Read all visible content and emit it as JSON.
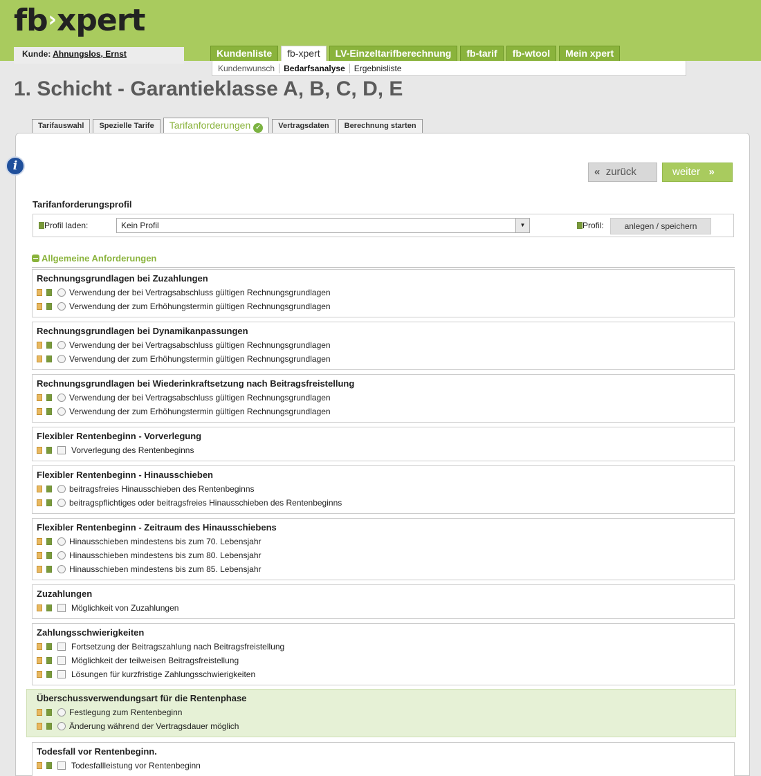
{
  "header": {
    "logo_left": "fb",
    "logo_right": "xpert",
    "customer_label": "Kunde:",
    "customer_name": "Ahnungslos, Ernst",
    "tabs": [
      {
        "label": "Kundenliste",
        "active": false
      },
      {
        "label": "fb-xpert",
        "active": true
      },
      {
        "label": "LV-Einzeltarifberechnung",
        "active": false
      },
      {
        "label": "fb-tarif",
        "active": false
      },
      {
        "label": "fb-wtool",
        "active": false
      },
      {
        "label": "Mein xpert",
        "active": false
      }
    ],
    "subnav": [
      {
        "label": "Kundenwunsch",
        "active": false
      },
      {
        "label": "Bedarfsanalyse",
        "active": true
      },
      {
        "label": "Ergebnisliste",
        "active": false
      }
    ]
  },
  "page_title": "1. Schicht - Garantieklasse A, B, C, D, E",
  "subtabs": [
    {
      "label": "Tarifauswahl",
      "active": false
    },
    {
      "label": "Spezielle Tarife",
      "active": false
    },
    {
      "label": "Tarifanforderungen",
      "active": true
    },
    {
      "label": "Vertragsdaten",
      "active": false
    },
    {
      "label": "Berechnung starten",
      "active": false
    }
  ],
  "nav": {
    "back_label": "zurück",
    "next_label": "weiter"
  },
  "profile": {
    "title": "Tarifanforderungsprofil",
    "load_label": "Profil laden:",
    "select_value": "Kein Profil",
    "profile_label": "Profil:",
    "save_label": "anlegen / speichern"
  },
  "section_title": "Allgemeine Anforderungen",
  "groups": [
    {
      "title": "Rechnungsgrundlagen bei Zuzahlungen",
      "control": "radio",
      "highlight": false,
      "options": [
        "Verwendung der bei Vertragsabschluss gültigen Rechnungsgrundlagen",
        "Verwendung der zum Erhöhungstermin gültigen Rechnungsgrundlagen"
      ]
    },
    {
      "title": "Rechnungsgrundlagen bei Dynamikanpassungen",
      "control": "radio",
      "highlight": false,
      "options": [
        "Verwendung der bei Vertragsabschluss gültigen Rechnungsgrundlagen",
        "Verwendung der zum Erhöhungstermin gültigen Rechnungsgrundlagen"
      ]
    },
    {
      "title": "Rechnungsgrundlagen bei Wiederinkraftsetzung nach Beitragsfreistellung",
      "control": "radio",
      "highlight": false,
      "options": [
        "Verwendung der bei Vertragsabschluss gültigen Rechnungsgrundlagen",
        "Verwendung der zum Erhöhungstermin gültigen Rechnungsgrundlagen"
      ]
    },
    {
      "title": "Flexibler Rentenbeginn - Vorverlegung",
      "control": "checkbox",
      "highlight": false,
      "options": [
        "Vorverlegung des Rentenbeginns"
      ]
    },
    {
      "title": "Flexibler Rentenbeginn - Hinausschieben",
      "control": "radio",
      "highlight": false,
      "options": [
        "beitragsfreies Hinausschieben des Rentenbeginns",
        "beitragspflichtiges oder beitragsfreies Hinausschieben des Rentenbeginns"
      ]
    },
    {
      "title": "Flexibler Rentenbeginn - Zeitraum des Hinausschiebens",
      "control": "radio",
      "highlight": false,
      "options": [
        "Hinausschieben mindestens bis zum 70. Lebensjahr",
        "Hinausschieben mindestens bis zum 80. Lebensjahr",
        "Hinausschieben mindestens bis zum 85. Lebensjahr"
      ]
    },
    {
      "title": "Zuzahlungen",
      "control": "checkbox",
      "highlight": false,
      "options": [
        "Möglichkeit von Zuzahlungen"
      ]
    },
    {
      "title": "Zahlungsschwierigkeiten",
      "control": "checkbox",
      "highlight": false,
      "options": [
        "Fortsetzung der Beitragszahlung nach Beitragsfreistellung",
        "Möglichkeit der teilweisen Beitragsfreistellung",
        "Lösungen für kurzfristige Zahlungsschwierigkeiten"
      ]
    },
    {
      "title": "Überschussverwendungsart für die Rentenphase",
      "control": "radio",
      "highlight": true,
      "options": [
        "Festlegung zum Rentenbeginn",
        "Änderung während der Vertragsdauer möglich"
      ]
    },
    {
      "title": "Todesfall vor Rentenbeginn.",
      "control": "checkbox",
      "highlight": false,
      "options": [
        "Todesfallleistung vor Rentenbeginn"
      ]
    }
  ]
}
